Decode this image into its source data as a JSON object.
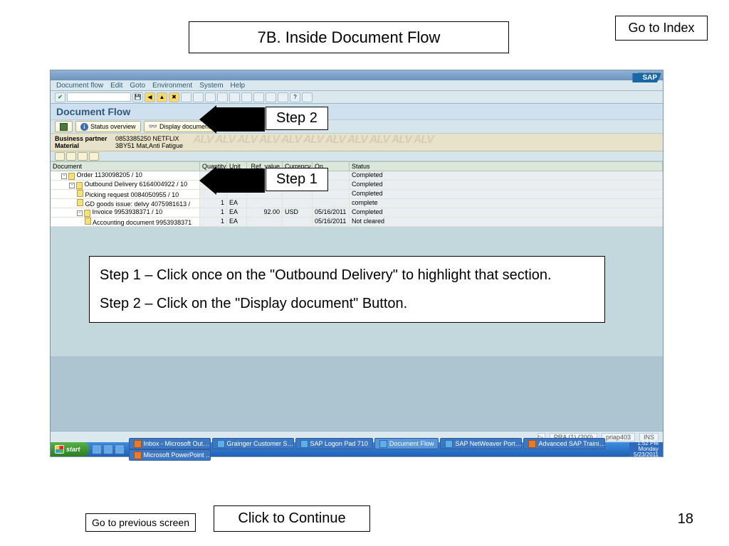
{
  "slide": {
    "title": "7B. Inside Document Flow",
    "index_link": "Go to Index",
    "step1_label": "Step 1",
    "step2_label": "Step 2",
    "instruction1": "Step 1 – Click once on the \"Outbound Delivery\" to highlight that section.",
    "instruction2": "Step 2 – Click on the \"Display document\" Button.",
    "prev_label": "Go to previous screen",
    "continue_label": "Click to Continue",
    "page_number": "18"
  },
  "sap": {
    "logo": "SAP",
    "menus": [
      "Document flow",
      "Edit",
      "Goto",
      "Environment",
      "System",
      "Help"
    ],
    "heading": "Document Flow",
    "buttons": {
      "status_overview": "Status overview",
      "display_document": "Display document"
    },
    "meta": {
      "partner_label": "Business partner",
      "partner_value": "0853385250 NETFLIX",
      "material_label": "Material",
      "material_value": "3BY51 Mat,Anti Fatigue",
      "alv_watermark": "ALV ALV ALV ALV ALV ALV ALV ALV ALV ALV ALV"
    },
    "grid_headers": {
      "doc": "Document",
      "qty": "Quantity",
      "unit": "Unit",
      "ref": "Ref. value",
      "cur": "Currency",
      "on": "On",
      "status": "Status"
    },
    "rows": [
      {
        "indent": 1,
        "toggle": "-",
        "label": "Order 1130098205 / 10",
        "qty": "",
        "unit": "",
        "ref": "",
        "cur": "",
        "on": "",
        "status": "Completed",
        "sel": false
      },
      {
        "indent": 2,
        "toggle": "-",
        "label": "Outbound Delivery 6164004922 / 10",
        "qty": "",
        "unit": "",
        "ref": "",
        "cur": "",
        "on": "",
        "status": "Completed",
        "sel": true
      },
      {
        "indent": 3,
        "toggle": "",
        "label": "Picking request 0084050955 / 10",
        "qty": "",
        "unit": "",
        "ref": "",
        "cur": "",
        "on": "",
        "status": "Completed",
        "sel": false
      },
      {
        "indent": 3,
        "toggle": "",
        "label": "GD goods issue: delvy 4075981613 /",
        "qty": "1",
        "unit": "EA",
        "ref": "",
        "cur": "",
        "on": "",
        "status": "complete",
        "sel": false
      },
      {
        "indent": 3,
        "toggle": "-",
        "label": "Invoice 9953938371 / 10",
        "qty": "1",
        "unit": "EA",
        "ref": "92.00",
        "cur": "USD",
        "on": "05/16/2011",
        "status": "Completed",
        "sel": false
      },
      {
        "indent": 4,
        "toggle": "",
        "label": "Accounting document 9953938371",
        "qty": "1",
        "unit": "EA",
        "ref": "",
        "cur": "",
        "on": "05/16/2011",
        "status": "Not cleared",
        "sel": false
      }
    ],
    "statusbar": {
      "sys": "PRA (1) (200)",
      "host": "priap403",
      "mode": "INS"
    }
  },
  "taskbar": {
    "start": "start",
    "tasks": [
      {
        "label": "Inbox - Microsoft Out…",
        "active": false,
        "color": "orange"
      },
      {
        "label": "Grainger Customer S…",
        "active": false,
        "color": "blue"
      },
      {
        "label": "SAP Logon Pad 710",
        "active": false,
        "color": "blue"
      },
      {
        "label": "Document Flow",
        "active": true,
        "color": "blue"
      },
      {
        "label": "SAP NetWeaver Port…",
        "active": false,
        "color": "blue"
      },
      {
        "label": "Advanced SAP Traini…",
        "active": false,
        "color": "orange"
      },
      {
        "label": "Microsoft PowerPoint …",
        "active": false,
        "color": "orange"
      }
    ],
    "clock": {
      "time": "1:52 PM",
      "day": "Monday",
      "date": "5/23/2011"
    }
  }
}
